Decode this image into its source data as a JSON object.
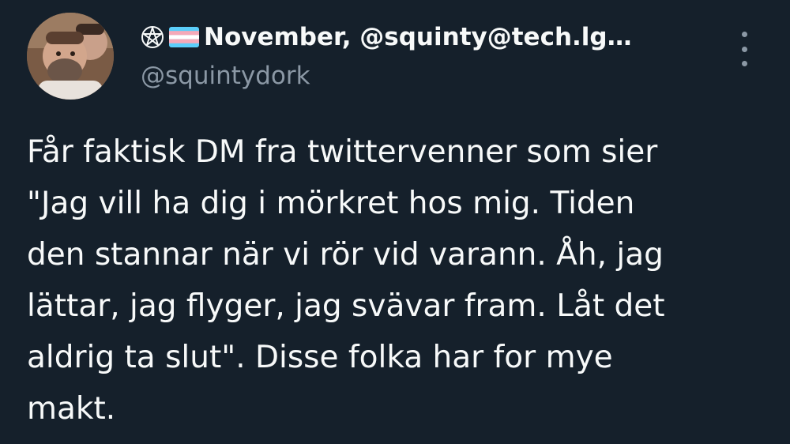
{
  "tweet": {
    "author": {
      "badges": [
        "pentagram-icon",
        "trans-flag-icon"
      ],
      "display_name": "November, @squinty@tech.lg…",
      "handle": "@squintydork"
    },
    "text": "Får faktisk DM fra twittervenner som sier\n\"Jag vill ha dig i mörkret hos mig. Tiden\nden stannar när vi rör vid varann. Åh, jag\nlättar, jag flyger, jag svävar fram. Låt det\naldrig ta slut\". Disse folka har for mye\nmakt."
  },
  "colors": {
    "background": "#15202b",
    "text_primary": "#f7f9f9",
    "text_secondary": "#8b98a5",
    "trans_blue": "#5bcefa",
    "trans_pink": "#f5a9b8"
  }
}
